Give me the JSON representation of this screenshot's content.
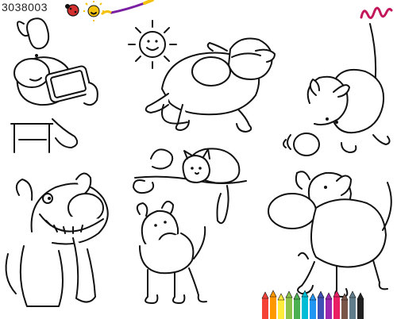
{
  "header": {
    "stock_id": "3038003"
  },
  "artwork": {
    "style": "black-and-white coloring page",
    "characters": [
      "dog-with-tablet",
      "sun",
      "dog-sleeping-mask",
      "dog-sniffing",
      "cat-on-branch",
      "dog-grinning",
      "dog-small-standing",
      "dog-walking"
    ],
    "icons": [
      "ladybug-icon",
      "sun-icon",
      "paintbrush-icon",
      "colored-pencils-icon",
      "squiggle-logo-icon"
    ],
    "colors": {
      "ink": "#111111",
      "paper": "#ffffff",
      "logo_magenta": "#c2185b",
      "ladybug_red": "#d32f2f",
      "sun_yellow": "#f4c20d",
      "brush_handle": "#7b1fa2"
    }
  }
}
